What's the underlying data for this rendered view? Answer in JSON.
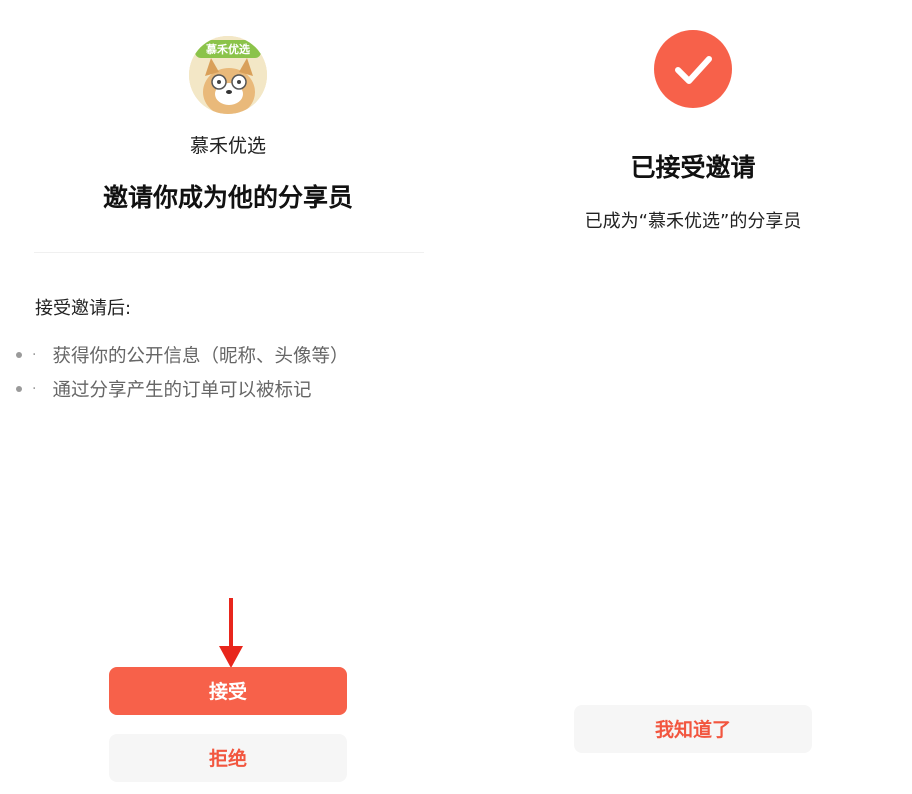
{
  "invite_panel": {
    "shop_name": "慕禾优选",
    "avatar_text": "慕禾优选",
    "title": "邀请你成为他的分享员",
    "after_accept_heading": "接受邀请后:",
    "benefits": [
      "获得你的公开信息（昵称、头像等）",
      "通过分享产生的订单可以被标记"
    ],
    "accept_label": "接受",
    "reject_label": "拒绝"
  },
  "success_panel": {
    "title": "已接受邀请",
    "description": "已成为“慕禾优选”的分享员",
    "ok_label": "我知道了"
  },
  "icons": {
    "avatar": "shop-avatar-cartoon-dog",
    "check": "check-icon",
    "arrow": "arrow-down-icon",
    "bullet": "bullet-dot-icon"
  },
  "colors": {
    "accent": "#f7614a",
    "accent_text": "#f2563f",
    "secondary_button_bg": "#f6f6f6",
    "muted_text": "#666666"
  }
}
